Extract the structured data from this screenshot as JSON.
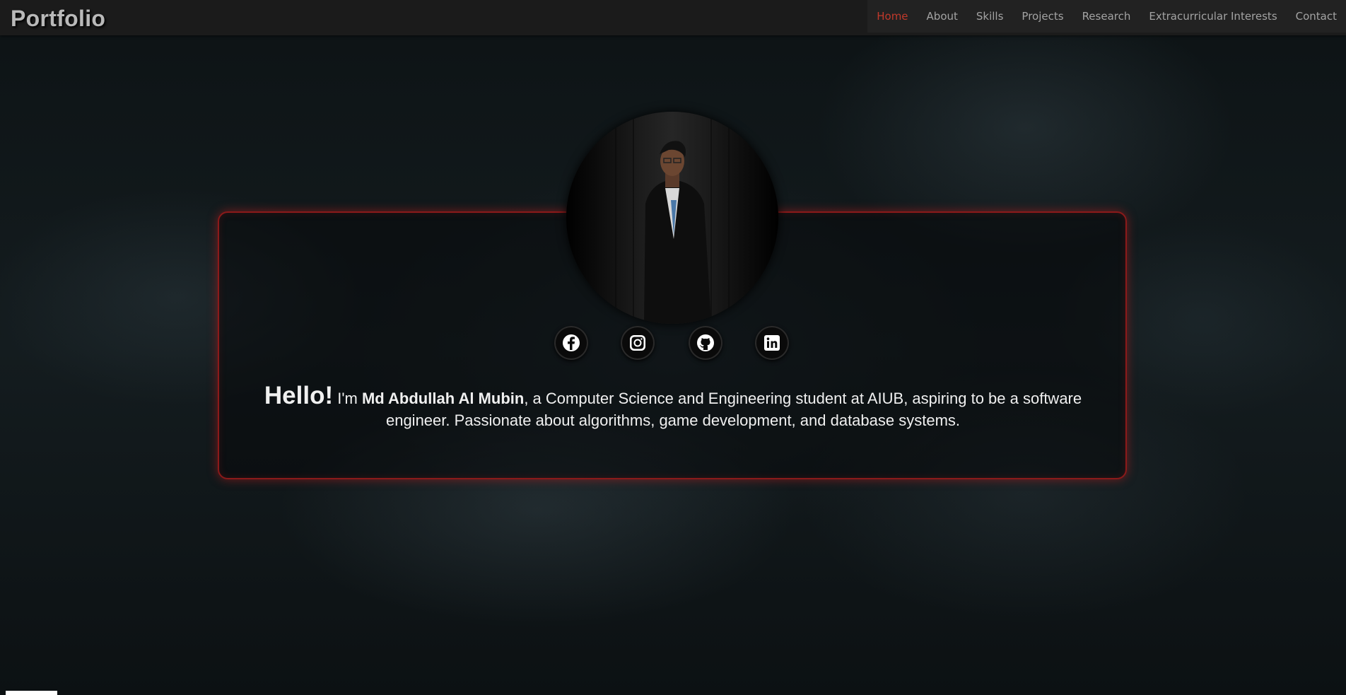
{
  "header": {
    "brand": "Portfolio",
    "nav": [
      {
        "label": "Home",
        "active": true
      },
      {
        "label": "About"
      },
      {
        "label": "Skills"
      },
      {
        "label": "Projects"
      },
      {
        "label": "Research"
      },
      {
        "label": "Extracurricular Interests"
      },
      {
        "label": "Contact"
      }
    ]
  },
  "hero": {
    "socials": [
      {
        "icon": "facebook-icon"
      },
      {
        "icon": "instagram-icon"
      },
      {
        "icon": "github-icon"
      },
      {
        "icon": "linkedin-icon"
      }
    ],
    "greeting": "Hello!",
    "pre_name": " I'm ",
    "name": "Md Abdullah Al Mubin",
    "description": ", a Computer Science and Engineering student at AIUB, aspiring to be a software engineer. Passionate about algorithms, game development, and database systems."
  },
  "colors": {
    "accent": "#c0392b",
    "card_border": "#8b1a1a",
    "nav_bg": "#1b1b1b"
  }
}
